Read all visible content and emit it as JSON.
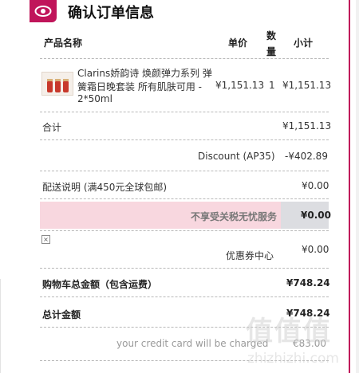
{
  "header": {
    "title": "确认订单信息"
  },
  "table": {
    "columns": {
      "product_name": "产品名称",
      "unit_price": "单价",
      "qty_line1": "数",
      "qty_line2": "量",
      "subtotal": "小计"
    }
  },
  "product": {
    "line1": "Clarins娇韵诗 焕颜弹力系列 弹",
    "line2": "簧霜日晚套装 所有肌肤可用 -",
    "line3": "2*50ml",
    "unit_price": "¥1,151.13",
    "qty": "1",
    "subtotal": "¥1,151.13"
  },
  "summary": {
    "total_label": "合计",
    "total_value": "¥1,151.13",
    "discount_label": "Discount (AP35)",
    "discount_value": "-¥402.89",
    "shipping_label": "配送说明 (满450元全球包邮)",
    "shipping_value": "¥0.00",
    "tax_label": "不享受关税无忧服务",
    "tax_value": "¥0.00",
    "coupon_label": "优惠券中心",
    "coupon_value": "¥0.00",
    "cart_total_label": "购物车总金额（包含运费）",
    "cart_total_value": "¥748.24",
    "grand_total_label": "总计金额",
    "grand_total_value": "¥748.24",
    "charge_note": "your credit card will be charged",
    "charge_value": "€83.00"
  },
  "watermark": {
    "logo": "值值值",
    "url": "zhizhizhi.com"
  },
  "colors": {
    "accent": "#c0155a",
    "pink": "#f8d7df",
    "gray_cell": "#dcdde1"
  }
}
